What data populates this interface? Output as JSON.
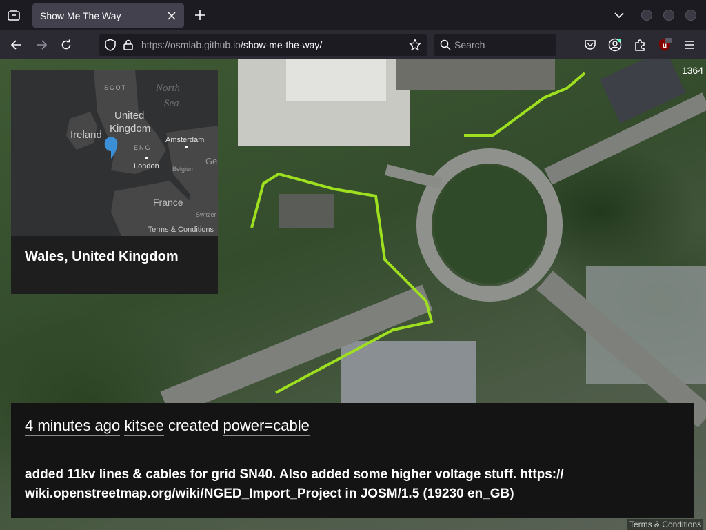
{
  "browser": {
    "tab_title": "Show Me The Way",
    "url_host": "https://osmlab.github.io",
    "url_path": "/show-me-the-way/",
    "search_placeholder": "Search"
  },
  "page": {
    "counter": "1364",
    "place": "Wales, United Kingdom",
    "minimap_terms": "Terms & Conditions",
    "page_terms": "Terms & Conditions",
    "minimap_labels": {
      "scot": "SCOT",
      "north_sea": "North",
      "north_sea2": "Sea",
      "uk": "United",
      "uk2": "Kingdom",
      "ireland": "Ireland",
      "eng": "ENG",
      "amsterdam": "Amsterdam",
      "london": "London",
      "belgium": "Belgium",
      "france": "France",
      "ge": "Ge",
      "switzer": "Switzer"
    },
    "change": {
      "time": "4 minutes ago",
      "user": "kitsee",
      "action": "created",
      "tag": "power=cable"
    },
    "comment": "added 11kv lines & cables for grid SN40. Also added some higher voltage stuff. https:// wiki.openstreetmap.org/wiki/NGED_Import_Project in JOSM/1.5 (19230 en_GB)"
  },
  "colors": {
    "line": "#9ee01f",
    "marker": "#3b8fd6"
  },
  "icons": [
    "tab-list-icon",
    "close-icon",
    "plus-icon",
    "chevron-down-icon",
    "back-icon",
    "forward-icon",
    "reload-icon",
    "shield-icon",
    "lock-icon",
    "star-icon",
    "search-icon",
    "pocket-icon",
    "account-icon",
    "extensions-icon",
    "ublock-icon",
    "menu-icon",
    "hamburger-icon",
    "map-marker-icon"
  ]
}
